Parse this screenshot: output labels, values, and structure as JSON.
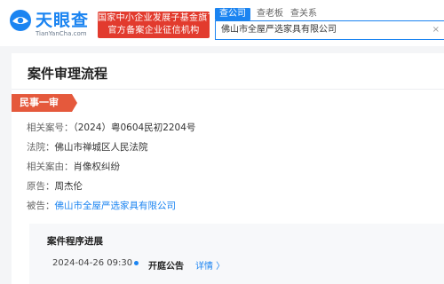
{
  "header": {
    "logo_text": "天眼查",
    "logo_domain": "TianYanCha.com",
    "badge_line1": "国家中小企业发展子基金旗下",
    "badge_line2": "官方备案企业征信机构",
    "tabs": [
      {
        "label": "查公司",
        "active": true
      },
      {
        "label": "查老板",
        "active": false
      },
      {
        "label": "查关系",
        "active": false
      }
    ],
    "search_value": "佛山市全屋严选家具有限公司",
    "search_clear": "×",
    "accent_color": "#1b84f1",
    "badge_color": "#e23b2e"
  },
  "case": {
    "title": "案件审理流程",
    "stage": "民事一审",
    "stage_color": "#e5593c",
    "rows": [
      {
        "label": "相关案号：",
        "value": "（2024）粤0604民初2204号",
        "link": false
      },
      {
        "label": "法院：",
        "value": "佛山市禅城区人民法院",
        "link": false
      },
      {
        "label": "相关案由：",
        "value": "肖像权纠纷",
        "link": false
      },
      {
        "label": "原告：",
        "value": "周杰伦",
        "link": false
      },
      {
        "label": "被告：",
        "value": "佛山市全屋严选家具有限公司",
        "link": true
      }
    ]
  },
  "progress": {
    "title": "案件程序进展",
    "events": [
      {
        "date": "2024-04-26 09:30",
        "event": "开庭公告",
        "detail": "详情 〉"
      }
    ]
  }
}
